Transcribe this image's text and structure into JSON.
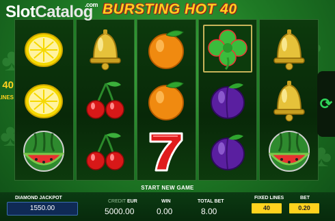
{
  "watermark": {
    "slot": "Slot",
    "catalog": "Catalog",
    "com": ".com"
  },
  "game": {
    "title": "BURSTING HOT 40"
  },
  "side_badge": {
    "value": "40",
    "label": "LINES"
  },
  "reels": [
    [
      "lemon",
      "lemon",
      "watermelon"
    ],
    [
      "bell",
      "cherry",
      "cherry"
    ],
    [
      "orange",
      "orange",
      "seven"
    ],
    [
      "clover",
      "plum",
      "plum"
    ],
    [
      "bell",
      "bell",
      "watermelon"
    ]
  ],
  "highlighted": "reel-4-row-1",
  "status": {
    "message": "START NEW GAME"
  },
  "jackpot": {
    "label": "DIAMOND JACKPOT",
    "value": "1550.00"
  },
  "credit": {
    "label": "CREDIT",
    "currency": "EUR",
    "value": "5000.00"
  },
  "win": {
    "label": "WIN",
    "value": "0.00"
  },
  "total_bet": {
    "label": "TOTAL BET",
    "value": "8.00"
  },
  "fixed_lines": {
    "label": "FIXED LINES",
    "value": "40"
  },
  "bet": {
    "label": "BET",
    "value": "0.20"
  },
  "colors": {
    "accent": "#ffd21e",
    "replay": "#2fd45a",
    "jackpot_border": "#3b6fb3"
  }
}
